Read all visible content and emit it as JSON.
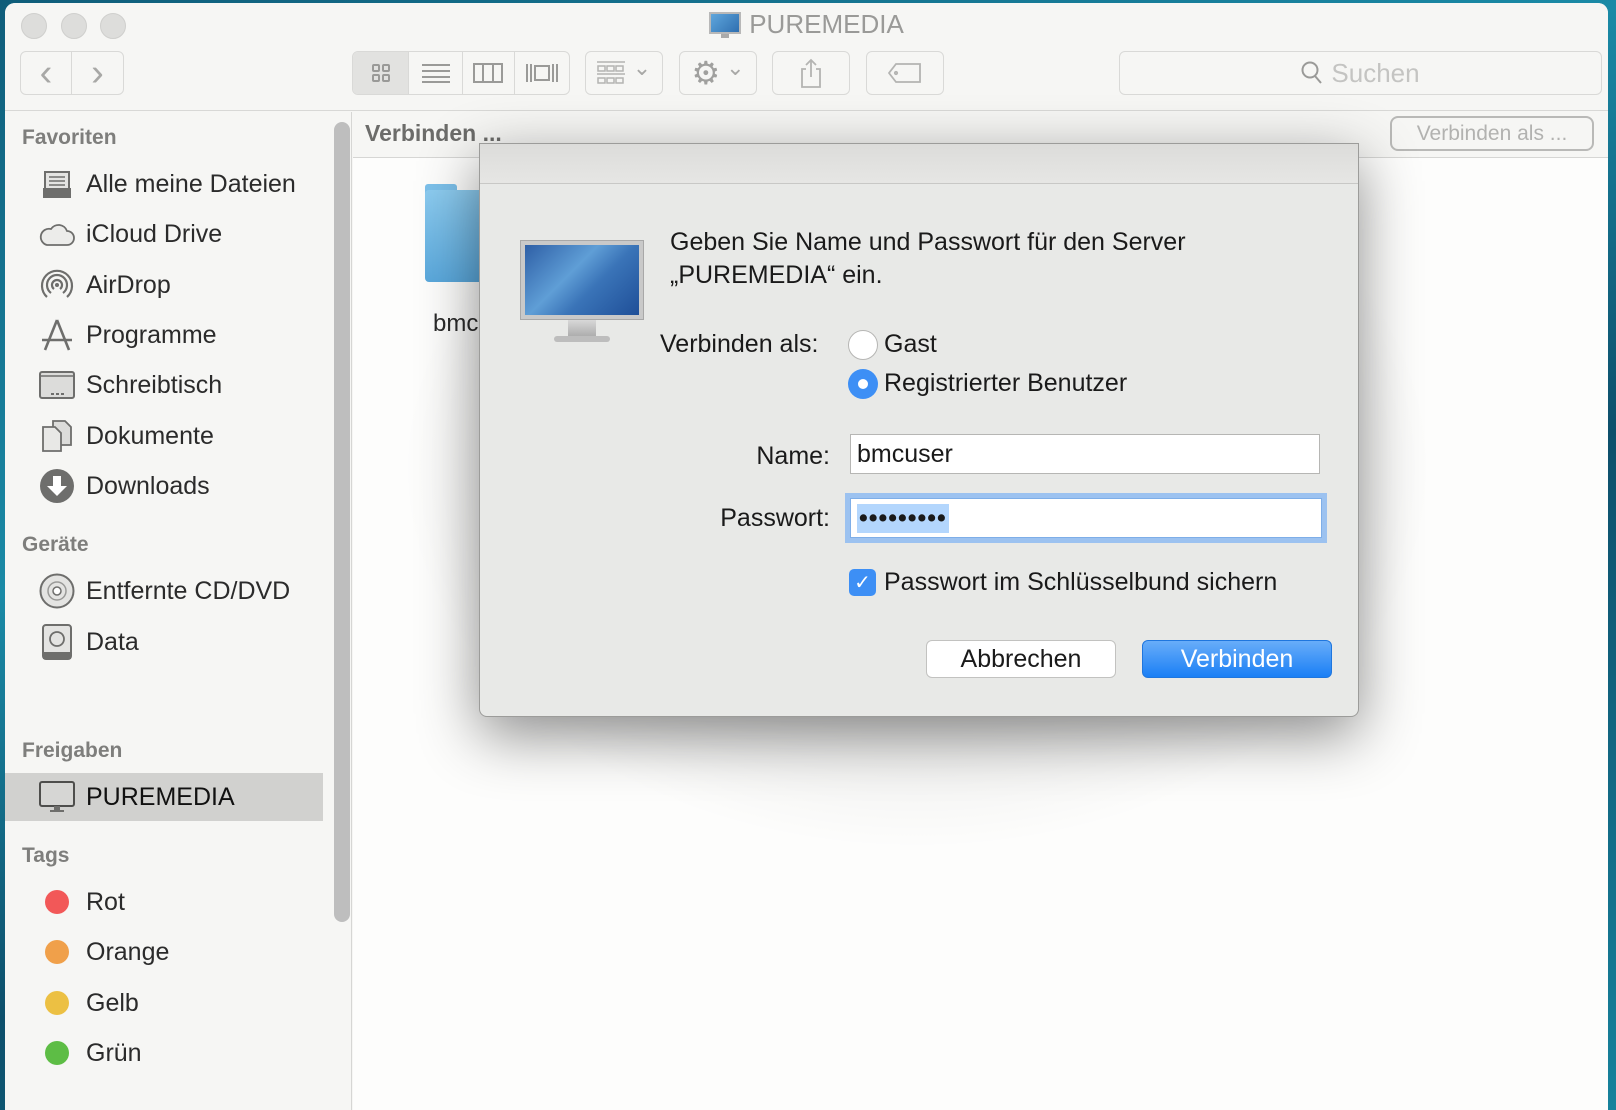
{
  "window": {
    "title": "PUREMEDIA",
    "title_icon": "monitor-icon"
  },
  "toolbar": {
    "back_icon": "chevron-left-icon",
    "forward_icon": "chevron-right-icon",
    "view_modes": [
      {
        "name": "icon-view",
        "icon": "grid-icon",
        "active": true
      },
      {
        "name": "list-view",
        "icon": "list-icon",
        "active": false
      },
      {
        "name": "column-view",
        "icon": "columns-icon",
        "active": false
      },
      {
        "name": "coverflow-view",
        "icon": "coverflow-icon",
        "active": false
      }
    ],
    "arrange_icon": "arrange-icon",
    "action_icon": "gear-icon",
    "share_icon": "share-icon",
    "tag_icon": "tag-icon",
    "search_placeholder": "Suchen",
    "back_glyph": "‹",
    "forward_glyph": "›",
    "chevron_glyph": "⌄",
    "gear_glyph": "⚙",
    "share_glyph": "⇪",
    "search_glyph": "⌕"
  },
  "sidebar": {
    "sections": {
      "favorites": "Favoriten",
      "devices": "Geräte",
      "shared": "Freigaben",
      "tags": "Tags"
    },
    "favorites": [
      {
        "label": "Alle meine Dateien",
        "icon": "all-files-icon",
        "glyph": "▤"
      },
      {
        "label": "iCloud Drive",
        "icon": "cloud-icon",
        "glyph": "☁"
      },
      {
        "label": "AirDrop",
        "icon": "airdrop-icon",
        "glyph": "◎"
      },
      {
        "label": "Programme",
        "icon": "applications-icon",
        "glyph": "⩓"
      },
      {
        "label": "Schreibtisch",
        "icon": "desktop-icon",
        "glyph": "▭"
      },
      {
        "label": "Dokumente",
        "icon": "documents-icon",
        "glyph": "❐"
      },
      {
        "label": "Downloads",
        "icon": "downloads-icon",
        "glyph": "⬇"
      }
    ],
    "devices": [
      {
        "label": "Entfernte CD/DVD",
        "icon": "disc-icon",
        "glyph": "◉"
      },
      {
        "label": "Data",
        "icon": "hard-drive-icon",
        "glyph": "▣"
      }
    ],
    "shared": [
      {
        "label": "PUREMEDIA",
        "icon": "monitor-icon",
        "glyph": "▭",
        "selected": true
      }
    ],
    "tags": [
      {
        "label": "Rot",
        "color": "#f25858"
      },
      {
        "label": "Orange",
        "color": "#f0a04a"
      },
      {
        "label": "Gelb",
        "color": "#ecc043"
      },
      {
        "label": "Grün",
        "color": "#5dbd45"
      }
    ]
  },
  "content": {
    "path_label": "Verbinden ...",
    "connect_as_button": "Verbinden als ...",
    "folder_label": "bmc"
  },
  "dialog": {
    "message": "Geben Sie Name und Passwort für den Server „PUREMEDIA“ ein.",
    "connect_as_label": "Verbinden als:",
    "options": [
      {
        "label": "Gast",
        "selected": false
      },
      {
        "label": "Registrierter Benutzer",
        "selected": true
      }
    ],
    "name_label": "Name:",
    "name_value": "bmcuser",
    "password_label": "Passwort:",
    "password_value": "•••••••••",
    "keychain_label": "Passwort im Schlüsselbund sichern",
    "keychain_checked": true,
    "check_glyph": "✓",
    "cancel_button": "Abbrechen",
    "connect_button": "Verbinden",
    "accent_color": "#3d8ff5"
  }
}
